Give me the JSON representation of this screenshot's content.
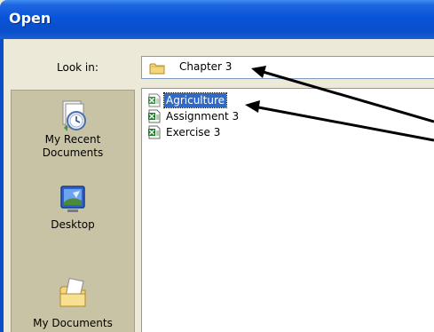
{
  "window": {
    "title": "Open"
  },
  "look_in": {
    "label": "Look in:",
    "value": "Chapter 3",
    "icon": "folder-icon"
  },
  "places": [
    {
      "label_line1": "My Recent",
      "label_line2": "Documents",
      "icon": "recent-documents-icon"
    },
    {
      "label_line1": "Desktop",
      "label_line2": "",
      "icon": "desktop-icon"
    },
    {
      "label_line1": "My Documents",
      "label_line2": "",
      "icon": "my-documents-icon"
    }
  ],
  "files": [
    {
      "name": "Agriculture",
      "selected": true,
      "icon": "excel-file-icon"
    },
    {
      "name": "Assignment 3",
      "selected": false,
      "icon": "excel-file-icon"
    },
    {
      "name": "Exercise 3",
      "selected": false,
      "icon": "excel-file-icon"
    }
  ],
  "colors": {
    "titlebar": "#0a4fc9",
    "selection": "#316ac5",
    "dialog_bg": "#ece9d8",
    "places_bg": "#c9c3a6"
  }
}
